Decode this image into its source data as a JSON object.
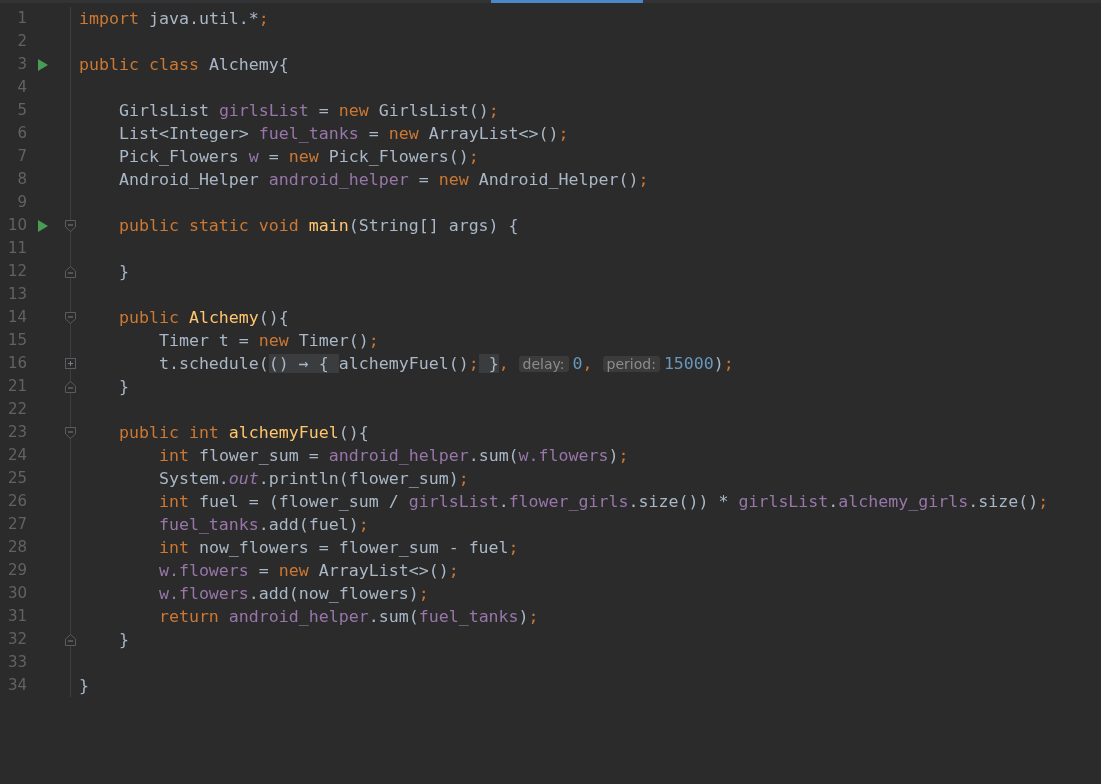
{
  "editor": {
    "lines": [
      {
        "n": "1",
        "run": false,
        "tokens": [
          {
            "kind": "keyword",
            "text": "import"
          },
          {
            "kind": "plain",
            "text": " java.util.*"
          },
          {
            "kind": "keyword",
            "text": ";"
          }
        ]
      },
      {
        "n": "2",
        "run": false
      },
      {
        "n": "3",
        "run": true,
        "tokens": [
          {
            "kind": "keyword",
            "text": "public class"
          },
          {
            "kind": "plain",
            "text": " Alchemy{"
          }
        ]
      },
      {
        "n": "4",
        "run": false
      },
      {
        "n": "5",
        "run": false,
        "tokens": [
          {
            "kind": "plain",
            "text": "    GirlsList "
          },
          {
            "kind": "field",
            "text": "girlsList"
          },
          {
            "kind": "plain",
            "text": " = "
          },
          {
            "kind": "keyword",
            "text": "new"
          },
          {
            "kind": "plain",
            "text": " GirlsList()"
          },
          {
            "kind": "keyword",
            "text": ";"
          }
        ]
      },
      {
        "n": "6",
        "run": false,
        "tokens": [
          {
            "kind": "plain",
            "text": "    List<Integer> "
          },
          {
            "kind": "field",
            "text": "fuel_tanks"
          },
          {
            "kind": "plain",
            "text": " = "
          },
          {
            "kind": "keyword",
            "text": "new"
          },
          {
            "kind": "plain",
            "text": " ArrayList<>()"
          },
          {
            "kind": "keyword",
            "text": ";"
          }
        ]
      },
      {
        "n": "7",
        "run": false,
        "tokens": [
          {
            "kind": "plain",
            "text": "    Pick_Flowers "
          },
          {
            "kind": "field",
            "text": "w"
          },
          {
            "kind": "plain",
            "text": " = "
          },
          {
            "kind": "keyword",
            "text": "new"
          },
          {
            "kind": "plain",
            "text": " Pick_Flowers()"
          },
          {
            "kind": "keyword",
            "text": ";"
          }
        ]
      },
      {
        "n": "8",
        "run": false,
        "tokens": [
          {
            "kind": "plain",
            "text": "    Android_Helper "
          },
          {
            "kind": "field",
            "text": "android_helper"
          },
          {
            "kind": "plain",
            "text": " = "
          },
          {
            "kind": "keyword",
            "text": "new"
          },
          {
            "kind": "plain",
            "text": " Android_Helper()"
          },
          {
            "kind": "keyword",
            "text": ";"
          }
        ]
      },
      {
        "n": "9",
        "run": false
      },
      {
        "n": "10",
        "run": true,
        "fold_marker": {
          "kind": "open"
        },
        "tokens": [
          {
            "kind": "keyword",
            "text": "    public static void"
          },
          {
            "kind": "method",
            "text": " main"
          },
          {
            "kind": "plain",
            "text": "(String[] args) {"
          }
        ]
      },
      {
        "n": "11",
        "run": false
      },
      {
        "n": "12",
        "run": false,
        "fold_marker": {
          "kind": "close"
        },
        "tokens": [
          {
            "kind": "plain",
            "text": "    }"
          }
        ]
      },
      {
        "n": "13",
        "run": false
      },
      {
        "n": "14",
        "run": false,
        "fold_marker": {
          "kind": "open"
        },
        "tokens": [
          {
            "kind": "keyword",
            "text": "    public"
          },
          {
            "kind": "method",
            "text": " Alchemy"
          },
          {
            "kind": "plain",
            "text": "(){"
          }
        ]
      },
      {
        "n": "15",
        "run": false,
        "tokens": [
          {
            "kind": "plain",
            "text": "        Timer t = "
          },
          {
            "kind": "keyword",
            "text": "new"
          },
          {
            "kind": "plain",
            "text": " Timer()"
          },
          {
            "kind": "keyword",
            "text": ";"
          }
        ]
      },
      {
        "n": "16",
        "run": false,
        "fold_marker": {
          "kind": "collapsed"
        },
        "tokens": [
          {
            "kind": "plain",
            "text": "        t.schedule("
          },
          {
            "kind": "folded",
            "text": "() → { "
          },
          {
            "kind": "plain",
            "text": "alchemyFuel()"
          },
          {
            "kind": "keyword",
            "text": ";"
          },
          {
            "kind": "folded",
            "text": " }"
          },
          {
            "kind": "keyword",
            "text": ", "
          },
          {
            "kind": "hint",
            "text": "delay:"
          },
          {
            "kind": "number",
            "text": "0"
          },
          {
            "kind": "keyword",
            "text": ", "
          },
          {
            "kind": "hint",
            "text": "period:"
          },
          {
            "kind": "number",
            "text": "15000"
          },
          {
            "kind": "plain",
            "text": ")"
          },
          {
            "kind": "keyword",
            "text": ";"
          }
        ]
      },
      {
        "n": "21",
        "run": false,
        "fold_marker": {
          "kind": "close"
        },
        "tokens": [
          {
            "kind": "plain",
            "text": "    }"
          }
        ]
      },
      {
        "n": "22",
        "run": false
      },
      {
        "n": "23",
        "run": false,
        "fold_marker": {
          "kind": "open"
        },
        "tokens": [
          {
            "kind": "keyword",
            "text": "    public int"
          },
          {
            "kind": "method",
            "text": " alchemyFuel"
          },
          {
            "kind": "plain",
            "text": "(){"
          }
        ]
      },
      {
        "n": "24",
        "run": false,
        "tokens": [
          {
            "kind": "keyword",
            "text": "        int"
          },
          {
            "kind": "plain",
            "text": " flower_sum = "
          },
          {
            "kind": "field",
            "text": "android_helper"
          },
          {
            "kind": "plain",
            "text": ".sum("
          },
          {
            "kind": "field",
            "text": "w.flowers"
          },
          {
            "kind": "plain",
            "text": ")"
          },
          {
            "kind": "keyword",
            "text": ";"
          }
        ]
      },
      {
        "n": "25",
        "run": false,
        "tokens": [
          {
            "kind": "plain",
            "text": "        System."
          },
          {
            "kind": "static",
            "text": "out"
          },
          {
            "kind": "plain",
            "text": ".println(flower_sum)"
          },
          {
            "kind": "keyword",
            "text": ";"
          }
        ]
      },
      {
        "n": "26",
        "run": false,
        "tokens": [
          {
            "kind": "keyword",
            "text": "        int"
          },
          {
            "kind": "plain",
            "text": " fuel = (flower_sum / "
          },
          {
            "kind": "field",
            "text": "girlsList"
          },
          {
            "kind": "plain",
            "text": "."
          },
          {
            "kind": "field",
            "text": "flower_girls"
          },
          {
            "kind": "plain",
            "text": ".size()) * "
          },
          {
            "kind": "field",
            "text": "girlsList"
          },
          {
            "kind": "plain",
            "text": "."
          },
          {
            "kind": "field",
            "text": "alchemy_girls"
          },
          {
            "kind": "plain",
            "text": ".size()"
          },
          {
            "kind": "keyword",
            "text": ";"
          }
        ]
      },
      {
        "n": "27",
        "run": false,
        "tokens": [
          {
            "kind": "field",
            "text": "        fuel_tanks"
          },
          {
            "kind": "plain",
            "text": ".add(fuel)"
          },
          {
            "kind": "keyword",
            "text": ";"
          }
        ]
      },
      {
        "n": "28",
        "run": false,
        "tokens": [
          {
            "kind": "keyword",
            "text": "        int"
          },
          {
            "kind": "plain",
            "text": " now_flowers = flower_sum - fuel"
          },
          {
            "kind": "keyword",
            "text": ";"
          }
        ]
      },
      {
        "n": "29",
        "run": false,
        "tokens": [
          {
            "kind": "field",
            "text": "        w.flowers"
          },
          {
            "kind": "plain",
            "text": " = "
          },
          {
            "kind": "keyword",
            "text": "new"
          },
          {
            "kind": "plain",
            "text": " ArrayList<>()"
          },
          {
            "kind": "keyword",
            "text": ";"
          }
        ]
      },
      {
        "n": "30",
        "run": false,
        "tokens": [
          {
            "kind": "field",
            "text": "        w.flowers"
          },
          {
            "kind": "plain",
            "text": ".add(now_flowers)"
          },
          {
            "kind": "keyword",
            "text": ";"
          }
        ]
      },
      {
        "n": "31",
        "run": false,
        "tokens": [
          {
            "kind": "keyword",
            "text": "        return"
          },
          {
            "kind": "field",
            "text": " android_helper"
          },
          {
            "kind": "plain",
            "text": ".sum("
          },
          {
            "kind": "field",
            "text": "fuel_tanks"
          },
          {
            "kind": "plain",
            "text": ")"
          },
          {
            "kind": "keyword",
            "text": ";"
          }
        ]
      },
      {
        "n": "32",
        "run": false,
        "fold_marker": {
          "kind": "close"
        },
        "tokens": [
          {
            "kind": "plain",
            "text": "    }"
          }
        ]
      },
      {
        "n": "33",
        "run": false
      },
      {
        "n": "34",
        "run": false,
        "tokens": [
          {
            "kind": "plain",
            "text": "}"
          }
        ]
      }
    ]
  }
}
